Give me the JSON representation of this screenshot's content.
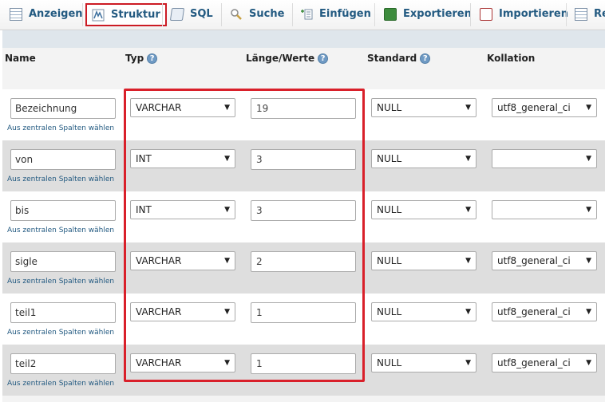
{
  "tabs": [
    {
      "label": "Anzeigen",
      "icon": "browse-table-icon",
      "active": false
    },
    {
      "label": "Struktur",
      "icon": "structure-icon",
      "active": true
    },
    {
      "label": "SQL",
      "icon": "sql-icon",
      "active": false
    },
    {
      "label": "Suche",
      "icon": "search-icon",
      "active": false
    },
    {
      "label": "Einfügen",
      "icon": "insert-icon",
      "active": false
    },
    {
      "label": "Exportieren",
      "icon": "export-icon",
      "active": false
    },
    {
      "label": "Importieren",
      "icon": "import-icon",
      "active": false
    },
    {
      "label": "Re",
      "icon": "table-icon",
      "active": false
    }
  ],
  "columns": {
    "name": "Name",
    "type": "Typ",
    "length": "Länge/Werte",
    "default": "Standard",
    "collation": "Kollation"
  },
  "central_link": "Aus zentralen Spalten wählen",
  "rows": [
    {
      "name": "Bezeichnung",
      "type": "VARCHAR",
      "length": "19",
      "default": "NULL",
      "collation": "utf8_general_ci"
    },
    {
      "name": "von",
      "type": "INT",
      "length": "3",
      "default": "NULL",
      "collation": ""
    },
    {
      "name": "bis",
      "type": "INT",
      "length": "3",
      "default": "NULL",
      "collation": ""
    },
    {
      "name": "sigle",
      "type": "VARCHAR",
      "length": "2",
      "default": "NULL",
      "collation": "utf8_general_ci"
    },
    {
      "name": "teil1",
      "type": "VARCHAR",
      "length": "1",
      "default": "NULL",
      "collation": "utf8_general_ci"
    },
    {
      "name": "teil2",
      "type": "VARCHAR",
      "length": "1",
      "default": "NULL",
      "collation": "utf8_general_ci"
    }
  ],
  "colors": {
    "accent": "#235a81",
    "highlight": "#d9202a",
    "row_alt": "#dedede"
  }
}
